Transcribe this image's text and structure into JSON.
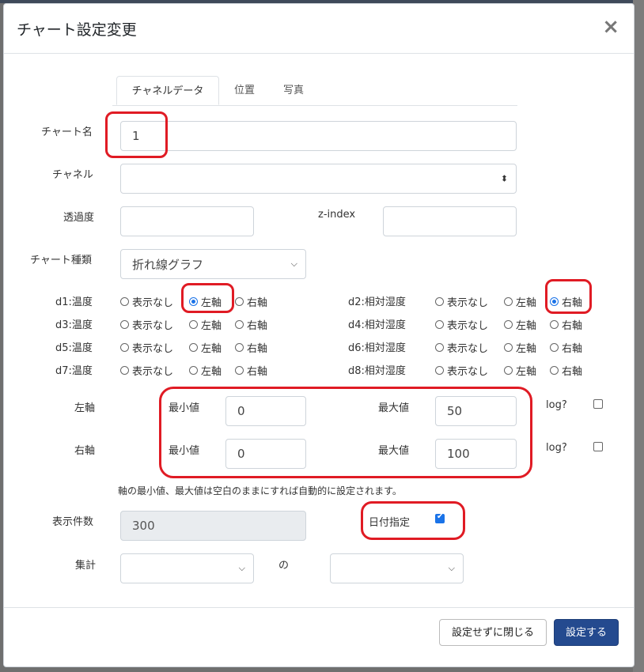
{
  "dialog": {
    "title": "チャート設定変更",
    "close": "×"
  },
  "tabs": [
    "チャネルデータ",
    "位置",
    "写真"
  ],
  "fields": {
    "chart_name": {
      "label": "チャート名",
      "value": "1"
    },
    "channel": {
      "label": "チャネル",
      "value": ""
    },
    "opacity": {
      "label": "透過度",
      "value": ""
    },
    "zindex": {
      "label": "z-index",
      "value": ""
    },
    "chart_type": {
      "label": "チャート種類",
      "value": "折れ線グラフ"
    }
  },
  "series_options": {
    "none": "表示なし",
    "left": "左軸",
    "right": "右軸"
  },
  "series": [
    {
      "name": "d1:温度",
      "selected": "left"
    },
    {
      "name": "d2:相対湿度",
      "selected": "right"
    },
    {
      "name": "d3:温度",
      "selected": ""
    },
    {
      "name": "d4:相対湿度",
      "selected": ""
    },
    {
      "name": "d5:温度",
      "selected": ""
    },
    {
      "name": "d6:相対湿度",
      "selected": ""
    },
    {
      "name": "d7:温度",
      "selected": ""
    },
    {
      "name": "d8:相対湿度",
      "selected": ""
    }
  ],
  "axes": {
    "min_label": "最小値",
    "max_label": "最大値",
    "log_label": "log?",
    "left": {
      "label": "左軸",
      "min": "0",
      "max": "50",
      "log": false
    },
    "right": {
      "label": "右軸",
      "min": "0",
      "max": "100",
      "log": false
    },
    "note": "軸の最小値、最大値は空白のままにすれば自動的に設定されます。"
  },
  "display_count": {
    "label": "表示件数",
    "value": "300"
  },
  "date_spec": {
    "label": "日付指定",
    "checked": true
  },
  "aggregate": {
    "label": "集計",
    "of": "の",
    "value1": "",
    "value2": ""
  },
  "buttons": {
    "close_without_save": "設定せずに閉じる",
    "save": "設定する"
  },
  "colors": {
    "accent": "#1a73e8",
    "primary_button": "#244a8f",
    "annotation": "#e01b24"
  }
}
